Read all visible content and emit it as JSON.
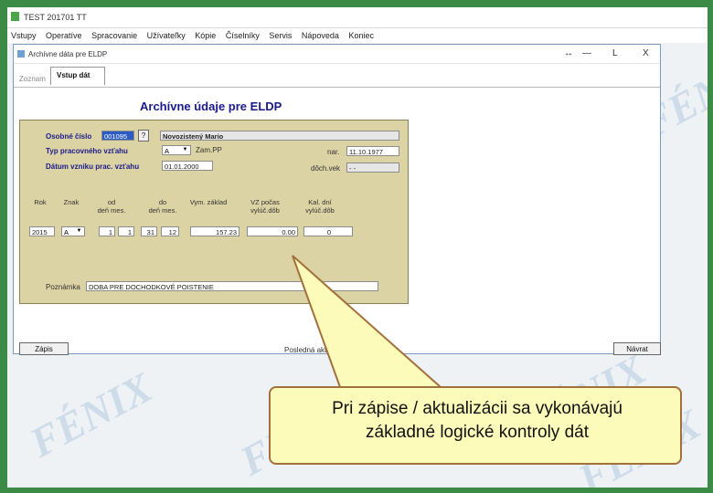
{
  "app": {
    "title": "TEST 201701 TT",
    "menu": [
      "Vstupy",
      "Operatíve",
      "Spracovanie",
      "Užívateľky",
      "Kópie",
      "Číselníky",
      "Servis",
      "Nápoveda",
      "Koniec"
    ]
  },
  "dialog": {
    "title": "Archívne dáta pre ELDP",
    "controls": {
      "restore": "↔",
      "minimize": "—",
      "maximize": "L",
      "close": "X"
    },
    "tabs": {
      "inactive": "Zoznam",
      "active": "Vstup dát"
    },
    "heading": "Archívne údaje pre ELDP",
    "form": {
      "personal_number_label": "Osobné číslo",
      "personal_number_value": "001095",
      "lookup_button": "?",
      "name_value": "Novozistený Mario",
      "employment_type_label": "Typ pracovného vzťahu",
      "employment_type_value": "A",
      "employment_type_desc": "Zam.PP",
      "birth_label": "nar.",
      "birth_value": "11.10.1977",
      "employment_start_label": "Dátum vzniku prac. vzťahu",
      "employment_start_value": "01.01.2000",
      "pension_label": "dôch.vek",
      "pension_value": "- -"
    },
    "grid": {
      "headers": {
        "year": "Rok",
        "flag": "Znak",
        "from_label": "od",
        "from_sub": "deň   mes.",
        "to_label": "do",
        "to_sub": "deň   mes.",
        "earnings": "Vym. základ",
        "vz_days_label": "VZ počas",
        "vz_days_sub": "vylúč.dôb",
        "cal_days_label": "Kal. dní",
        "cal_days_sub": "vylúč.dôb"
      },
      "row": {
        "year": "2015",
        "flag": "A",
        "from_day": "1",
        "from_month": "1",
        "to_day": "31",
        "to_month": "12",
        "earnings": "157.23",
        "vz_days": "0.00",
        "cal_days": "0"
      }
    },
    "note_label": "Poznámka",
    "note_value": "DOBA PRE DOCHODKOVÉ POISTENIE",
    "buttons": {
      "save": "Zápis",
      "cancel": "Návrat"
    },
    "footer_label": "Posledná aktualizácia"
  },
  "callout": {
    "line1": "Pri zápise / aktualizácii sa vykonávajú",
    "line2": "základné logické kontroly dát"
  },
  "watermark": "FÉNIX",
  "colors": {
    "frame": "#3b8a45",
    "panel": "#dcd3a4",
    "heading": "#1a1a8c",
    "callout_fill": "#fdfbb9",
    "callout_border": "#a2703a"
  }
}
